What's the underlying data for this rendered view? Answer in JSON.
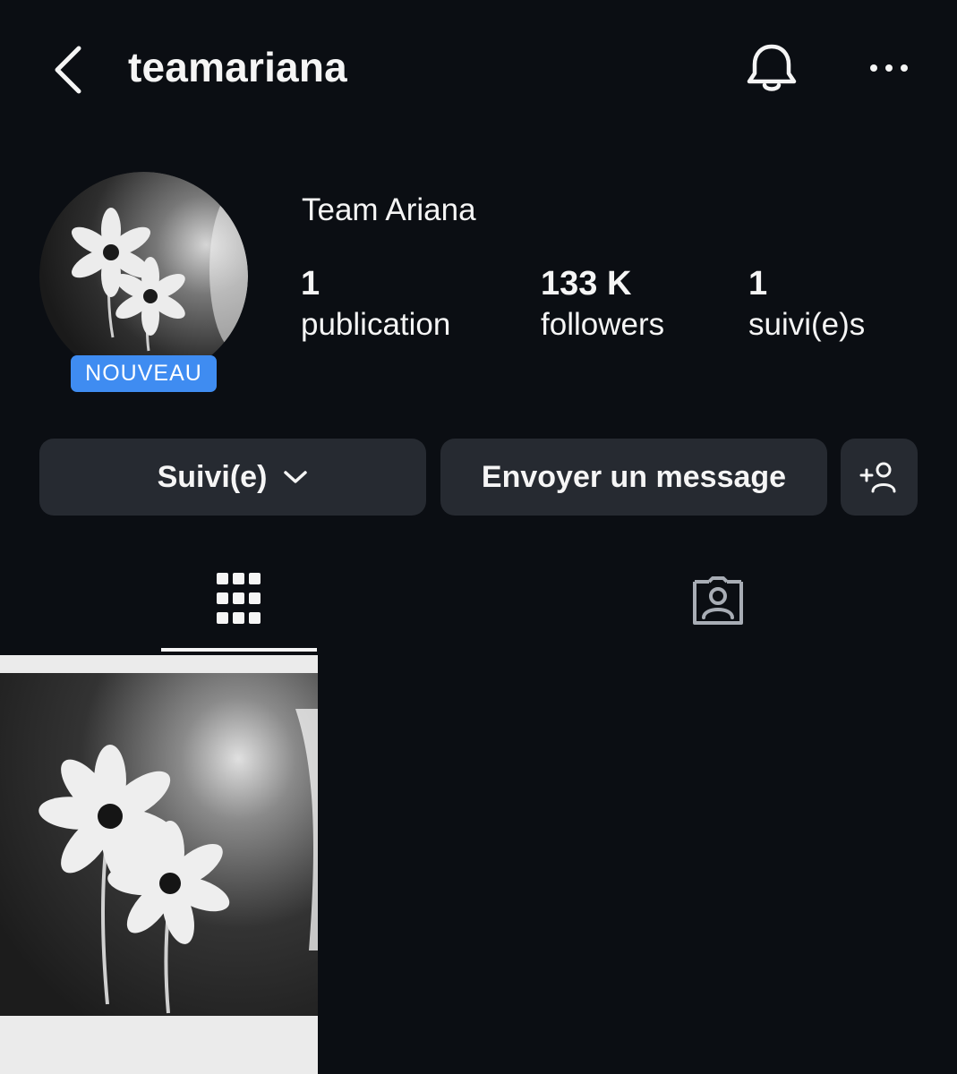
{
  "header": {
    "username": "teamariana",
    "back_icon": "chevron-left-icon",
    "bell_icon": "bell-icon",
    "more_icon": "more-horizontal-icon"
  },
  "profile": {
    "display_name": "Team Ariana",
    "badge": "NOUVEAU",
    "stats": {
      "posts": {
        "value": "1",
        "label": "publication"
      },
      "followers": {
        "value": "133 K",
        "label": "followers"
      },
      "following": {
        "value": "1",
        "label": "suivi(e)s"
      }
    }
  },
  "actions": {
    "follow_label": "Suivi(e)",
    "message_label": "Envoyer un message",
    "add_user_icon": "add-user-icon"
  },
  "tabs": [
    {
      "icon": "grid-icon",
      "active": true
    },
    {
      "icon": "tagged-user-icon",
      "active": false
    }
  ],
  "colors": {
    "background": "#0b0e13",
    "button": "#262a31",
    "badge": "#3f8cf1",
    "text": "#f5f5f5",
    "inactive_icon": "#a8adb5"
  }
}
